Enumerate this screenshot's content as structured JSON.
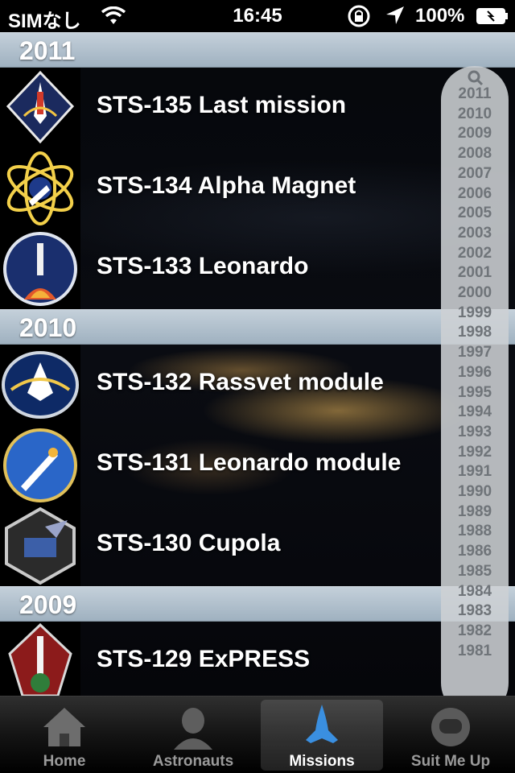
{
  "status_bar": {
    "carrier": "SIMなし",
    "time": "16:45",
    "battery": "100%"
  },
  "sections": [
    {
      "year": "2011",
      "missions": [
        {
          "title": "STS-135 Last mission",
          "patch_icon": "sts-135-patch-icon"
        },
        {
          "title": "STS-134 Alpha Magnet",
          "patch_icon": "sts-134-patch-icon"
        },
        {
          "title": "STS-133 Leonardo",
          "patch_icon": "sts-133-patch-icon"
        }
      ]
    },
    {
      "year": "2010",
      "missions": [
        {
          "title": "STS-132 Rassvet module",
          "patch_icon": "sts-132-patch-icon"
        },
        {
          "title": "STS-131 Leonardo module",
          "patch_icon": "sts-131-patch-icon"
        },
        {
          "title": "STS-130 Cupola",
          "patch_icon": "sts-130-patch-icon"
        }
      ]
    },
    {
      "year": "2009",
      "missions": [
        {
          "title": "STS-129 ExPRESS",
          "patch_icon": "sts-129-patch-icon"
        }
      ]
    }
  ],
  "year_index": [
    "2011",
    "2010",
    "2009",
    "2008",
    "2007",
    "2006",
    "2005",
    "2003",
    "2002",
    "2001",
    "2000",
    "1999",
    "1998",
    "1997",
    "1996",
    "1995",
    "1994",
    "1993",
    "1992",
    "1991",
    "1990",
    "1989",
    "1988",
    "1986",
    "1985",
    "1984",
    "1983",
    "1982",
    "1981"
  ],
  "tabs": [
    {
      "label": "Home",
      "icon": "home-icon"
    },
    {
      "label": "Astronauts",
      "icon": "astronaut-icon"
    },
    {
      "label": "Missions",
      "icon": "shuttle-icon",
      "active": true
    },
    {
      "label": "Suit Me Up",
      "icon": "helmet-icon"
    }
  ],
  "colors": {
    "section_header": "#b0bfcb",
    "tab_active_label": "#ffffff",
    "tab_inactive_label": "#9a9a9a",
    "index_text": "#6f7479"
  }
}
